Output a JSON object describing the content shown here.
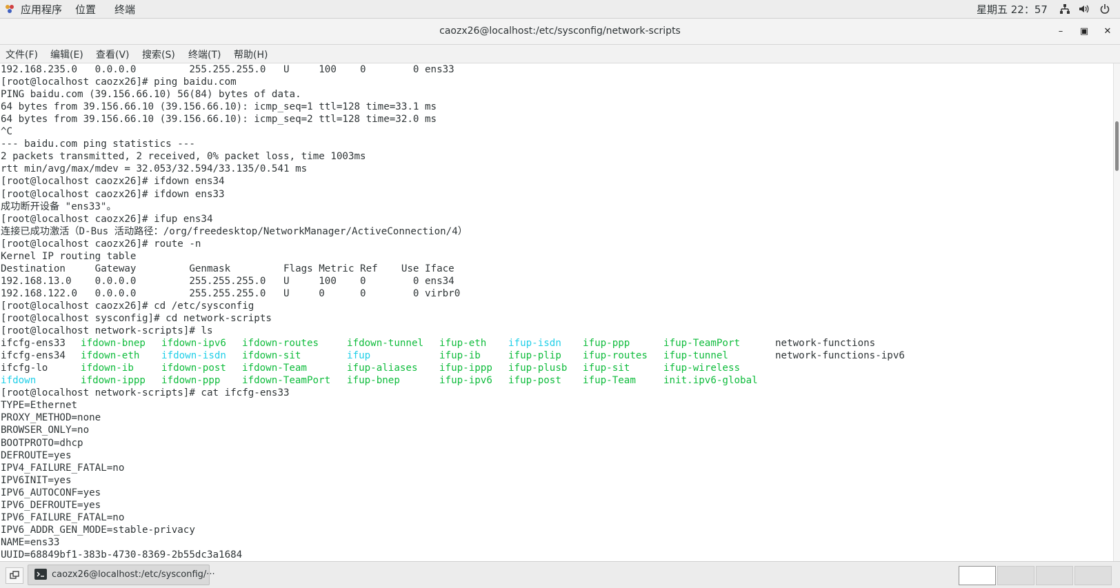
{
  "topbar": {
    "apps": "应用程序",
    "places": "位置",
    "terminal": "终端",
    "clock": "星期五 22：57"
  },
  "window": {
    "title": "caozx26@localhost:/etc/sysconfig/network-scripts"
  },
  "menubar": [
    "文件(F)",
    "编辑(E)",
    "查看(V)",
    "搜索(S)",
    "终端(T)",
    "帮助(H)"
  ],
  "terminal": {
    "lines": [
      "192.168.235.0   0.0.0.0         255.255.255.0   U     100    0        0 ens33",
      "[root@localhost caozx26]# ping baidu.com",
      "PING baidu.com (39.156.66.10) 56(84) bytes of data.",
      "64 bytes from 39.156.66.10 (39.156.66.10): icmp_seq=1 ttl=128 time=33.1 ms",
      "64 bytes from 39.156.66.10 (39.156.66.10): icmp_seq=2 ttl=128 time=32.0 ms",
      "^C",
      "--- baidu.com ping statistics ---",
      "2 packets transmitted, 2 received, 0% packet loss, time 1003ms",
      "rtt min/avg/max/mdev = 32.053/32.594/33.135/0.541 ms",
      "[root@localhost caozx26]# ifdown ens34",
      "[root@localhost caozx26]# ifdown ens33",
      "成功断开设备 \"ens33\"。",
      "[root@localhost caozx26]# ifup ens34",
      "连接已成功激活（D-Bus 活动路径：/org/freedesktop/NetworkManager/ActiveConnection/4）",
      "[root@localhost caozx26]# route -n",
      "Kernel IP routing table",
      "Destination     Gateway         Genmask         Flags Metric Ref    Use Iface",
      "192.168.13.0    0.0.0.0         255.255.255.0   U     100    0        0 ens34",
      "192.168.122.0   0.0.0.0         255.255.255.0   U     0      0        0 virbr0",
      "[root@localhost caozx26]# cd /etc/sysconfig",
      "[root@localhost sysconfig]# cd network-scripts",
      "[root@localhost network-scripts]# ls"
    ],
    "ls_rows": [
      [
        "ifcfg-ens33",
        "ifdown-bnep",
        "ifdown-ipv6",
        "ifdown-routes",
        "ifdown-tunnel",
        "ifup-eth",
        "ifup-isdn",
        "ifup-ppp",
        "ifup-TeamPort",
        "network-functions"
      ],
      [
        "ifcfg-ens34",
        "ifdown-eth",
        "ifdown-isdn",
        "ifdown-sit",
        "ifup",
        "ifup-ib",
        "ifup-plip",
        "ifup-routes",
        "ifup-tunnel",
        "network-functions-ipv6"
      ],
      [
        "ifcfg-lo",
        "ifdown-ib",
        "ifdown-post",
        "ifdown-Team",
        "ifup-aliases",
        "ifup-ippp",
        "ifup-plusb",
        "ifup-sit",
        "ifup-wireless",
        ""
      ],
      [
        "ifdown",
        "ifdown-ippp",
        "ifdown-ppp",
        "ifdown-TeamPort",
        "ifup-bnep",
        "ifup-ipv6",
        "ifup-post",
        "ifup-Team",
        "init.ipv6-global",
        ""
      ]
    ],
    "ls_colors": [
      [
        "default",
        "green",
        "green",
        "green",
        "green",
        "green",
        "cyan",
        "green",
        "green",
        "default"
      ],
      [
        "default",
        "green",
        "cyan",
        "green",
        "cyan",
        "green",
        "green",
        "green",
        "green",
        "default"
      ],
      [
        "default",
        "green",
        "green",
        "green",
        "green",
        "green",
        "green",
        "green",
        "green",
        "default"
      ],
      [
        "cyan",
        "green",
        "green",
        "green",
        "green",
        "green",
        "green",
        "green",
        "green",
        "default"
      ]
    ],
    "after_lines": [
      "[root@localhost network-scripts]# cat ifcfg-ens33",
      "TYPE=Ethernet",
      "PROXY_METHOD=none",
      "BROWSER_ONLY=no",
      "BOOTPROTO=dhcp",
      "DEFROUTE=yes",
      "IPV4_FAILURE_FATAL=no",
      "IPV6INIT=yes",
      "IPV6_AUTOCONF=yes",
      "IPV6_DEFROUTE=yes",
      "IPV6_FAILURE_FATAL=no",
      "IPV6_ADDR_GEN_MODE=stable-privacy",
      "NAME=ens33",
      "UUID=68849bf1-383b-4730-8369-2b55dc3a1684"
    ]
  },
  "colors": {
    "default": "#2e3436",
    "green": "#0fbc3c",
    "cyan": "#1fcfe8"
  },
  "taskbar": {
    "task_label": "caozx26@localhost:/etc/sysconfig/···"
  }
}
